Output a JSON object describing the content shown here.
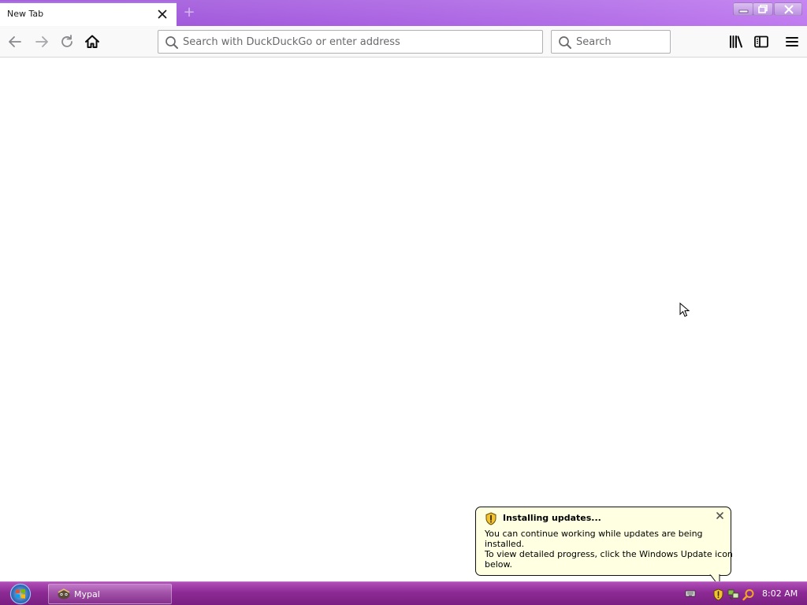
{
  "browser": {
    "tab": {
      "title": "New Tab",
      "close_icon": "close-icon"
    },
    "new_tab_icon": "plus-icon",
    "window_controls": [
      "minimize-icon",
      "restore-icon",
      "close-icon"
    ],
    "nav": {
      "icons": [
        "back-arrow-icon",
        "forward-arrow-icon",
        "reload-icon",
        "home-icon"
      ]
    },
    "address_bar": {
      "placeholder": "Search with DuckDuckGo or enter address",
      "icon": "search-icon"
    },
    "search_bar": {
      "placeholder": "Search",
      "icon": "search-icon"
    },
    "toolbar_icons": [
      "library-icon",
      "sidebar-icon",
      "hamburger-menu-icon"
    ]
  },
  "notification": {
    "title": "Installing updates...",
    "icon": "shield-icon",
    "lines": [
      "You can continue working while updates are being",
      "installed.",
      "To view detailed progress, click the Windows Update icon",
      "below."
    ],
    "close_icon": "close-icon"
  },
  "taskbar": {
    "start_icon": "windows-start-icon",
    "task_item": {
      "label": "Mypal",
      "icon": "mypal-icon"
    },
    "tray_icons": [
      "keyboard-icon",
      "windows-update-shield-icon",
      "network-icon",
      "search-icon"
    ],
    "clock": "8:02 AM"
  },
  "colors": {
    "titlebar": "#a75ee0",
    "taskbar": "#8d2a95",
    "balloon_bg": "#ffffe1"
  }
}
